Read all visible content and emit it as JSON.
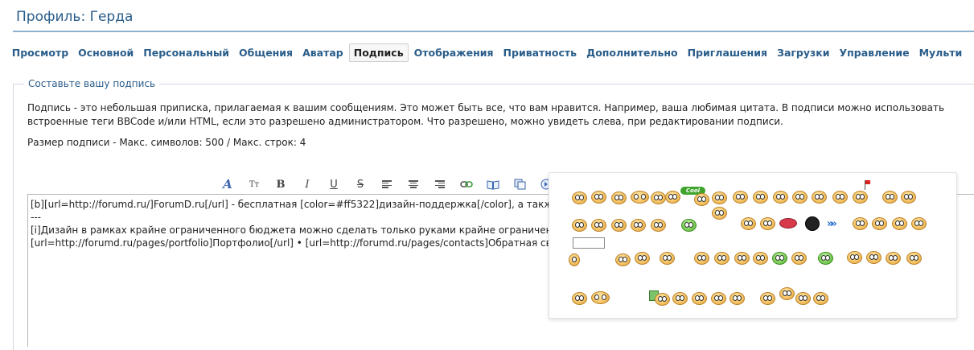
{
  "page": {
    "title": "Профиль: Герда"
  },
  "tabs": [
    {
      "label": "Просмотр"
    },
    {
      "label": "Основной"
    },
    {
      "label": "Персональный"
    },
    {
      "label": "Общения"
    },
    {
      "label": "Аватар"
    },
    {
      "label": "Подпись",
      "active": true
    },
    {
      "label": "Отображения"
    },
    {
      "label": "Приватность"
    },
    {
      "label": "Дополнительно"
    },
    {
      "label": "Приглашения"
    },
    {
      "label": "Загрузки"
    },
    {
      "label": "Управление"
    },
    {
      "label": "Мульти"
    }
  ],
  "section": {
    "legend": "Составьте вашу подпись",
    "description": "Подпись - это небольшая приписка, прилагаемая к вашим сообщениям. Это может быть все, что вам нравится. Например, ваша любимая цитата. В подписи можно использовать встроенные теги BBCode и/или HTML, если это разрешено администратором. Что разрешено, можно увидеть слева, при редактировании подписи.",
    "limits": "Размер подписи - Макс. символов: 500 / Макс. строк: 4"
  },
  "toolbar": {
    "font_glyph": "A",
    "size_glyph": "Tт",
    "bold_glyph": "B",
    "italic_glyph": "I",
    "underline_glyph": "U",
    "strike_glyph": "S"
  },
  "editor": {
    "value": "[b][url=http://forumd.ru/]ForumD.ru[/url] - бесплатная [color=#ff5322]дизайн-поддержка[/color], а также ку\n---\n[i]Дизайн в рамках крайне ограниченного бюджета можно сделать только руками крайне ограниченного ди\n[url=http://forumd.ru/pages/portfolio]Портфолио[/url] • [url=http://forumd.ru/pages/contacts]Обратная связь"
  },
  "smilies": {
    "cool_label": "Cool",
    "colors": {
      "yellow": "#f6c465",
      "green": "#7fd25a",
      "red": "#d83a4a",
      "blue": "#2a6fd0"
    }
  },
  "colors": {
    "title": "#2a5d8a",
    "tab_link": "#2a5d8a",
    "rule": "#8fb2d0"
  }
}
